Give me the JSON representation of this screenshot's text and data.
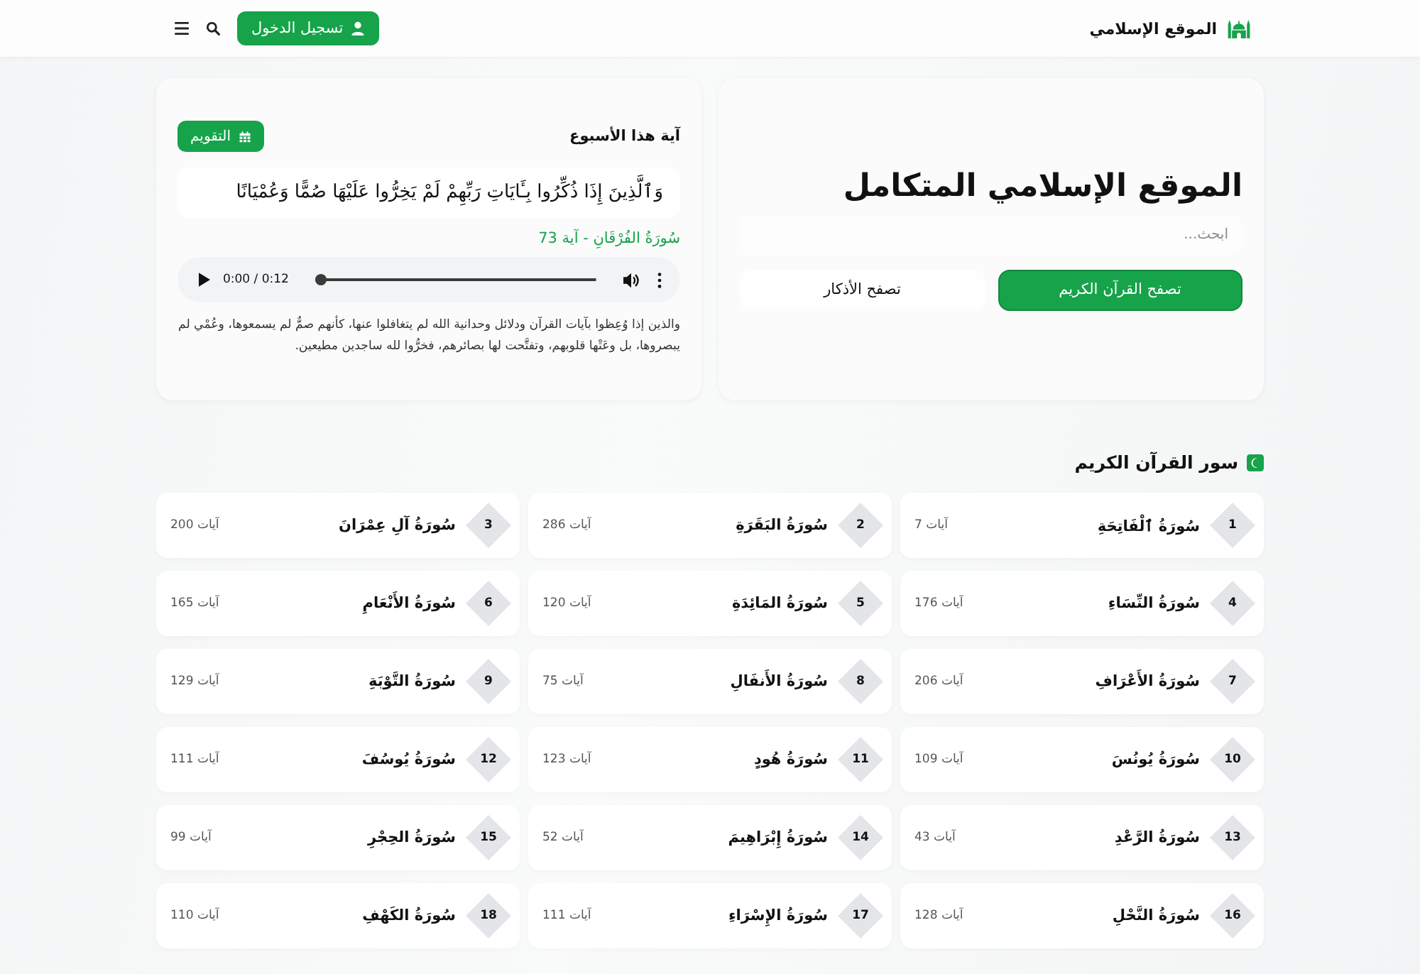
{
  "header": {
    "site_name": "الموقع الإسلامي",
    "login_button": "تسجيل الدخول"
  },
  "hero": {
    "title": "الموقع الإسلامي المتكامل",
    "search": {
      "placeholder": "ابحث..."
    },
    "buttons": [
      {
        "label": "تصفح القرآن الكريم",
        "kind": "primary"
      },
      {
        "label": "تصفح الأذكار",
        "kind": "secondary"
      }
    ]
  },
  "verse_of_week": {
    "heading": "آية هذا الأسبوع",
    "calendar_button": "التقويم",
    "verse": "وَٱلَّذِينَ إِذَا ذُكِّرُوا بِـَٔايَاتِ رَبِّهِمْ لَمْ يَخِرُّوا عَلَيْهَا صُمًّا وَعُمْيَانًا",
    "reference": "سُورَةُ الفُرْقَانِ - آية 73",
    "audio": {
      "time": "0:00 / 0:12",
      "level": 0
    },
    "tafsir": "والذين إذا وُعِظوا بآيات القرآن ودلائل وحدانية الله لم يتغافلوا عنها، كأنهم صمٌّ لم يسمعوها، وعُمْي لم يبصروها، بل وعَتْها قلوبهم، وتفتَّحت لها بصائرهم، فخرُّوا لله ساجدين مطيعين."
  },
  "surahs": {
    "title": "سور القرآن الكريم",
    "items": [
      {
        "number": "1",
        "name": "سُورَةُ ٱلْفَاتِحَةِ",
        "verses": "7 آيات"
      },
      {
        "number": "2",
        "name": "سُورَةُ البَقَرَةِ",
        "verses": "286 آيات"
      },
      {
        "number": "3",
        "name": "سُورَةُ آلِ عِمْرَانَ",
        "verses": "200 آيات"
      },
      {
        "number": "4",
        "name": "سُورَةُ النِّسَاءِ",
        "verses": "176 آيات"
      },
      {
        "number": "5",
        "name": "سُورَةُ المَائِدَةِ",
        "verses": "120 آيات"
      },
      {
        "number": "6",
        "name": "سُورَةُ الأَنْعَامِ",
        "verses": "165 آيات"
      },
      {
        "number": "7",
        "name": "سُورَةُ الأَعْرَافِ",
        "verses": "206 آيات"
      },
      {
        "number": "8",
        "name": "سُورَةُ الأَنفَالِ",
        "verses": "75 آيات"
      },
      {
        "number": "9",
        "name": "سُورَةُ التَّوْبَةِ",
        "verses": "129 آيات"
      },
      {
        "number": "10",
        "name": "سُورَةُ يُونُسَ",
        "verses": "109 آيات"
      },
      {
        "number": "11",
        "name": "سُورَةُ هُودٍ",
        "verses": "123 آيات"
      },
      {
        "number": "12",
        "name": "سُورَةُ يُوسُفَ",
        "verses": "111 آيات"
      },
      {
        "number": "13",
        "name": "سُورَةُ الرَّعْدِ",
        "verses": "43 آيات"
      },
      {
        "number": "14",
        "name": "سُورَةُ إِبْرَاهِيمَ",
        "verses": "52 آيات"
      },
      {
        "number": "15",
        "name": "سُورَةُ الحِجْرِ",
        "verses": "99 آيات"
      },
      {
        "number": "16",
        "name": "سُورَةُ النَّحْلِ",
        "verses": "128 آيات"
      },
      {
        "number": "17",
        "name": "سُورَةُ الإِسْرَاءِ",
        "verses": "111 آيات"
      },
      {
        "number": "18",
        "name": "سُورَةُ الكَهْفِ",
        "verses": "110 آيات"
      }
    ]
  }
}
